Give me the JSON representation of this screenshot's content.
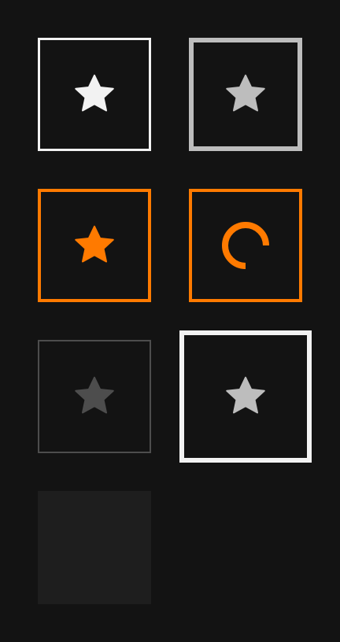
{
  "theme": {
    "background": "#131313",
    "accent": "#ff7a00",
    "white": "#f2f2f2",
    "light_gray": "#bdbdbd",
    "dim_gray": "#4d4d4d",
    "empty_fill": "#1e1e1e"
  },
  "tiles": [
    {
      "name": "star-tile-normal",
      "icon": "star-icon",
      "state": "normal"
    },
    {
      "name": "star-tile-hover",
      "icon": "star-icon",
      "state": "hover"
    },
    {
      "name": "star-tile-active",
      "icon": "star-icon",
      "state": "active"
    },
    {
      "name": "loading-tile",
      "icon": "loading-spinner-icon",
      "state": "loading"
    },
    {
      "name": "star-tile-disabled",
      "icon": "star-icon",
      "state": "disabled"
    },
    {
      "name": "star-tile-focused",
      "icon": "star-icon",
      "state": "focused"
    },
    {
      "name": "empty-tile",
      "icon": "",
      "state": "empty"
    }
  ]
}
